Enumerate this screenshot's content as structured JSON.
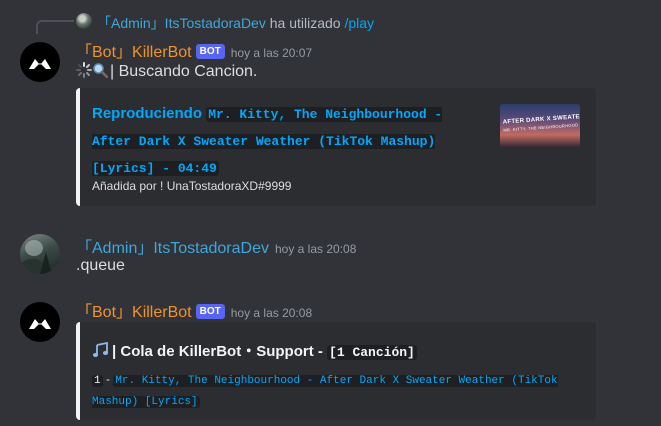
{
  "reply": {
    "user": "「Admin」ItsTostadoraDev",
    "text": "ha utilizado",
    "command": "/play"
  },
  "messages": [
    {
      "author": "「Bot」KillerBot",
      "badge": "BOT",
      "time": "hoy a las 20:07",
      "content": "| Buscando Cancion.",
      "embed": {
        "title_prefix": "Reproduciendo",
        "title_code": "Mr. Kitty, The Neighbourhood - After Dark X Sweater Weather (TikTok Mashup) [Lyrics] - 04:49",
        "footer": "Añadida por ! UnaTostadoraXD#9999",
        "thumbnail_text_1": "AFTER DARK X SWEATER WEATHER",
        "thumbnail_text_2": "MR. KITTY, THE NEIGHBOURHOOD"
      }
    },
    {
      "author": "「Admin」ItsTostadoraDev",
      "time": "hoy a las 20:08",
      "content": ".queue"
    },
    {
      "author": "「Bot」KillerBot",
      "badge": "BOT",
      "time": "hoy a las 20:08",
      "embed": {
        "title": "| Cola de KillerBot・Support -",
        "title_code": "[1 Canción]",
        "item_number": "1",
        "item_separator": "-",
        "item_song": "Mr. Kitty, The Neighbourhood - After Dark X Sweater Weather (TikTok Mashup) [Lyrics]"
      }
    }
  ],
  "icons": [
    "loading-spinner-icon",
    "magnifier-icon",
    "music-notes-icon",
    "bot-logo-icon"
  ],
  "colors": {
    "background": "#313338",
    "embed_background": "#2b2d31",
    "bot_name": "#f0932b",
    "admin_name": "#3fa7d9",
    "link": "#00a8fc",
    "badge": "#5865f2"
  }
}
